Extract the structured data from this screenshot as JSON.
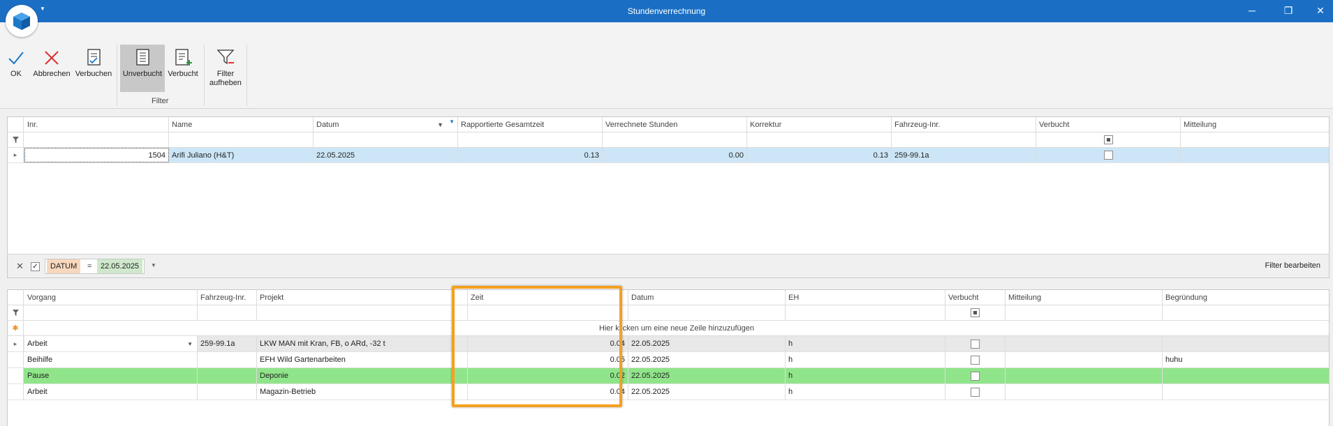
{
  "window": {
    "title": "Stundenverrechnung",
    "minimize": "─",
    "restore": "❐",
    "close": "✕"
  },
  "ribbon": {
    "ok": "OK",
    "abbrechen": "Abbrechen",
    "verbuchen": "Verbuchen",
    "unverbucht": "Unverbucht",
    "verbucht": "Verbucht",
    "filter_aufheben_1": "Filter",
    "filter_aufheben_2": "aufheben",
    "group_filter": "Filter"
  },
  "top_grid": {
    "headers": [
      "Inr.",
      "Name",
      "Datum",
      "Rapportierte Gesamtzeit",
      "Verrechnete Stunden",
      "Korrektur",
      "Fahrzeug-Inr.",
      "Verbucht",
      "Mitteilung"
    ],
    "rows": [
      {
        "inr": "1504",
        "name": "Arifi Juliano (H&T)",
        "datum": "22.05.2025",
        "gesamtzeit": "0.13",
        "verrechnet": "0.00",
        "korrektur": "0.13",
        "fahrzeug": "259-99.1a",
        "verbucht": false,
        "mitteilung": ""
      }
    ]
  },
  "filter_bar": {
    "field": "DATUM",
    "operator": "=",
    "value": "22.05.2025",
    "edit": "Filter bearbeiten"
  },
  "bottom_grid": {
    "headers": [
      "Vorgang",
      "Fahrzeug-Inr.",
      "Projekt",
      "Zeit",
      "Datum",
      "EH",
      "Verbucht",
      "Mitteilung",
      "Begründung"
    ],
    "new_row_hint": "Hier klicken um eine neue Zeile hinzuzufügen",
    "rows": [
      {
        "vorgang": "Arbeit",
        "fahrzeug": "259-99.1a",
        "projekt": "LKW MAN mit Kran, FB, o ARd, -32 t",
        "zeit": "0.04",
        "datum": "22.05.2025",
        "eh": "h",
        "verbucht": false,
        "mitteilung": "",
        "begruendung": ""
      },
      {
        "vorgang": "Beihilfe",
        "fahrzeug": "",
        "projekt": "EFH Wild Gartenarbeiten",
        "zeit": "0.05",
        "datum": "22.05.2025",
        "eh": "h",
        "verbucht": false,
        "mitteilung": "",
        "begruendung": "huhu"
      },
      {
        "vorgang": "Pause",
        "fahrzeug": "",
        "projekt": "Deponie",
        "zeit": "0.02",
        "datum": "22.05.2025",
        "eh": "h",
        "verbucht": false,
        "mitteilung": "",
        "begruendung": ""
      },
      {
        "vorgang": "Arbeit",
        "fahrzeug": "",
        "projekt": "Magazin-Betrieb",
        "zeit": "0.04",
        "datum": "22.05.2025",
        "eh": "h",
        "verbucht": false,
        "mitteilung": "",
        "begruendung": ""
      }
    ]
  },
  "colors": {
    "titlebar": "#1a6fc4",
    "selected_row": "#cde6f7",
    "pause_row": "#90e58a",
    "highlight": "#f4a020",
    "accent_red": "#e03030"
  },
  "icons": [
    "app-logo-icon",
    "checkmark-icon",
    "x-icon",
    "document-check-icon",
    "document-list-icon",
    "document-add-icon",
    "filter-remove-icon",
    "filter-icon",
    "sort-desc-icon",
    "expand-arrow-icon",
    "new-row-star-icon"
  ]
}
